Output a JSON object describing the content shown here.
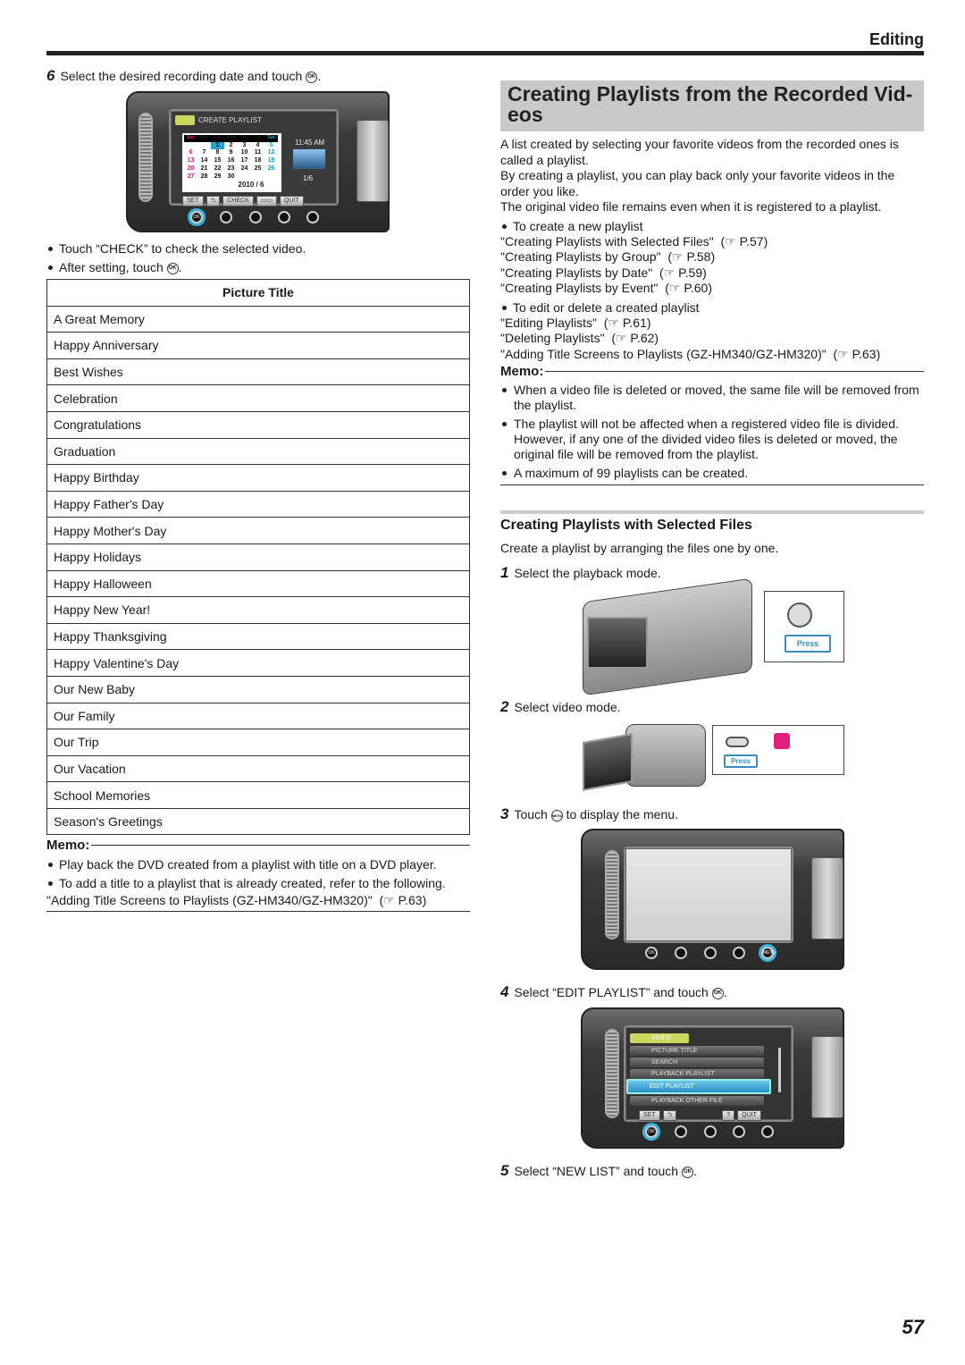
{
  "header": {
    "section": "Editing"
  },
  "left": {
    "step6": {
      "num": "6",
      "text": "Select the desired recording date and touch",
      "suffix": "."
    },
    "screen6": {
      "title": "CREATE PLAYLIST",
      "days": [
        "Sun",
        "Mon",
        "Tue",
        "Wed",
        "Thu",
        "Fri",
        "Sat"
      ],
      "dates": [
        "",
        "",
        "1",
        "2",
        "3",
        "4",
        "5",
        "6",
        "7",
        "8",
        "9",
        "10",
        "11",
        "12",
        "13",
        "14",
        "15",
        "16",
        "17",
        "18",
        "19",
        "20",
        "21",
        "22",
        "23",
        "24",
        "25",
        "26",
        "27",
        "28",
        "29",
        "30"
      ],
      "month": "2010 / 6",
      "time": "11:45 AM",
      "count": "1/6",
      "buttons": [
        "SET",
        "⮌",
        "CHECK",
        "▭▭",
        "QUIT"
      ]
    },
    "bullets": [
      "Touch “CHECK” to check the selected video.",
      "After setting, touch"
    ],
    "table": {
      "header": "Picture Title",
      "rows": [
        "A Great Memory",
        "Happy Anniversary",
        "Best Wishes",
        "Celebration",
        "Congratulations",
        "Graduation",
        "Happy Birthday",
        "Happy Father's Day",
        "Happy Mother's Day",
        "Happy Holidays",
        "Happy Halloween",
        "Happy New Year!",
        "Happy Thanksgiving",
        "Happy Valentine's Day",
        "Our New Baby",
        "Our Family",
        "Our Trip",
        "Our Vacation",
        "School Memories",
        "Season's Greetings"
      ]
    },
    "memo": {
      "title": "Memo:",
      "bullets": [
        "Play back the DVD created from a playlist with title on a DVD player.",
        "To add a title to a playlist that is already created, refer to the following."
      ],
      "link": "\"Adding Title Screens to Playlists (GZ-HM340/GZ-HM320)\"",
      "link_ref": "(☞ P.63)"
    }
  },
  "right": {
    "title": "Creating Playlists from the Recorded Vid-eos",
    "intro": [
      "A list created by selecting your favorite videos from the recorded ones is called a playlist.",
      "By creating a playlist, you can play back only your favorite videos in the order you like.",
      "The original video file remains even when it is registered to a playlist."
    ],
    "create_bullet": "To create a new playlist",
    "create_links": [
      {
        "t": "\"Creating Playlists with Selected Files\"",
        "r": "(☞ P.57)"
      },
      {
        "t": "\"Creating Playlists by Group\"",
        "r": "(☞ P.58)"
      },
      {
        "t": "\"Creating Playlists by Date\"",
        "r": "(☞ P.59)"
      },
      {
        "t": "\"Creating Playlists by Event\"",
        "r": "(☞ P.60)"
      }
    ],
    "edit_bullet": "To edit or delete a created playlist",
    "edit_links": [
      {
        "t": "\"Editing Playlists\"",
        "r": "(☞ P.61)"
      },
      {
        "t": "\"Deleting Playlists\"",
        "r": "(☞ P.62)"
      },
      {
        "t": "\"Adding Title Screens to Playlists (GZ-HM340/GZ-HM320)\"",
        "r": "(☞ P.63)"
      }
    ],
    "memo": {
      "title": "Memo:",
      "bullets": [
        "When a video file is deleted or moved, the same file will be removed from the playlist.",
        "The playlist will not be affected when a registered video file is divided. However, if any one of the divided video files is deleted or moved, the original file will be removed from the playlist.",
        "A maximum of 99 playlists can be created."
      ]
    },
    "sub_title": "Creating Playlists with Selected Files",
    "sub_intro": "Create a playlist by arranging the files one by one.",
    "steps": [
      {
        "num": "1",
        "text": "Select the playback mode."
      },
      {
        "num": "2",
        "text": "Select video mode."
      },
      {
        "num": "3",
        "pre": "Touch",
        "post": "to display the menu."
      },
      {
        "num": "4",
        "pre": "Select “EDIT PLAYLIST” and touch",
        "post": "."
      },
      {
        "num": "5",
        "pre": "Select “NEW LIST” and touch",
        "post": "."
      }
    ],
    "press_label": "Press",
    "menu": {
      "tab": "VIDEO",
      "items": [
        "PICTURE TITLE",
        "SEARCH",
        "PLAYBACK PLAYLIST",
        "EDIT PLAYLIST",
        "PLAYBACK OTHER FILE"
      ],
      "buttons": [
        "SET",
        "⮌",
        "?",
        "QUIT"
      ]
    }
  },
  "icons": {
    "ok": "OK",
    "menu": "MENU"
  },
  "page_number": "57",
  "colors": {
    "title_bg": "#c9c9c9",
    "highlight": "#3ab3d9"
  }
}
